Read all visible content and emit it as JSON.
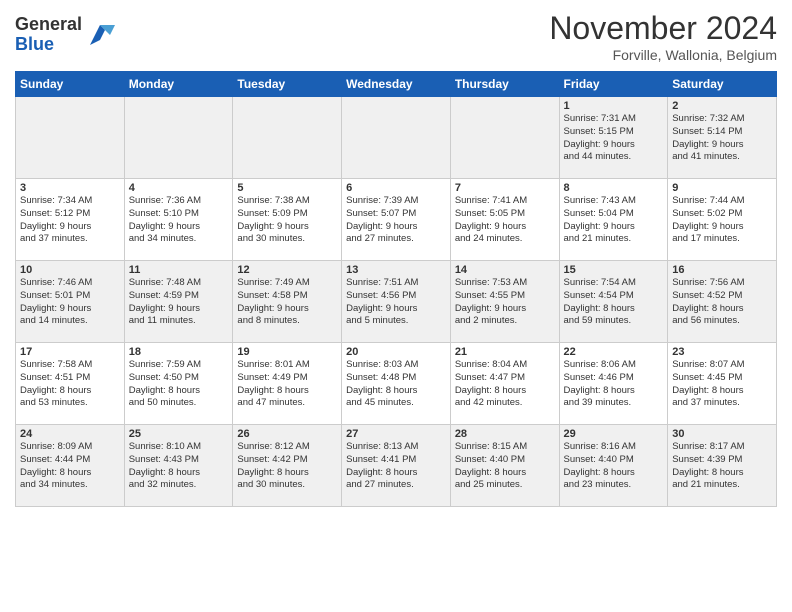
{
  "logo": {
    "line1": "General",
    "line2": "Blue"
  },
  "title": "November 2024",
  "location": "Forville, Wallonia, Belgium",
  "headers": [
    "Sunday",
    "Monday",
    "Tuesday",
    "Wednesday",
    "Thursday",
    "Friday",
    "Saturday"
  ],
  "weeks": [
    [
      {
        "day": "",
        "info": ""
      },
      {
        "day": "",
        "info": ""
      },
      {
        "day": "",
        "info": ""
      },
      {
        "day": "",
        "info": ""
      },
      {
        "day": "",
        "info": ""
      },
      {
        "day": "1",
        "info": "Sunrise: 7:31 AM\nSunset: 5:15 PM\nDaylight: 9 hours\nand 44 minutes."
      },
      {
        "day": "2",
        "info": "Sunrise: 7:32 AM\nSunset: 5:14 PM\nDaylight: 9 hours\nand 41 minutes."
      }
    ],
    [
      {
        "day": "3",
        "info": "Sunrise: 7:34 AM\nSunset: 5:12 PM\nDaylight: 9 hours\nand 37 minutes."
      },
      {
        "day": "4",
        "info": "Sunrise: 7:36 AM\nSunset: 5:10 PM\nDaylight: 9 hours\nand 34 minutes."
      },
      {
        "day": "5",
        "info": "Sunrise: 7:38 AM\nSunset: 5:09 PM\nDaylight: 9 hours\nand 30 minutes."
      },
      {
        "day": "6",
        "info": "Sunrise: 7:39 AM\nSunset: 5:07 PM\nDaylight: 9 hours\nand 27 minutes."
      },
      {
        "day": "7",
        "info": "Sunrise: 7:41 AM\nSunset: 5:05 PM\nDaylight: 9 hours\nand 24 minutes."
      },
      {
        "day": "8",
        "info": "Sunrise: 7:43 AM\nSunset: 5:04 PM\nDaylight: 9 hours\nand 21 minutes."
      },
      {
        "day": "9",
        "info": "Sunrise: 7:44 AM\nSunset: 5:02 PM\nDaylight: 9 hours\nand 17 minutes."
      }
    ],
    [
      {
        "day": "10",
        "info": "Sunrise: 7:46 AM\nSunset: 5:01 PM\nDaylight: 9 hours\nand 14 minutes."
      },
      {
        "day": "11",
        "info": "Sunrise: 7:48 AM\nSunset: 4:59 PM\nDaylight: 9 hours\nand 11 minutes."
      },
      {
        "day": "12",
        "info": "Sunrise: 7:49 AM\nSunset: 4:58 PM\nDaylight: 9 hours\nand 8 minutes."
      },
      {
        "day": "13",
        "info": "Sunrise: 7:51 AM\nSunset: 4:56 PM\nDaylight: 9 hours\nand 5 minutes."
      },
      {
        "day": "14",
        "info": "Sunrise: 7:53 AM\nSunset: 4:55 PM\nDaylight: 9 hours\nand 2 minutes."
      },
      {
        "day": "15",
        "info": "Sunrise: 7:54 AM\nSunset: 4:54 PM\nDaylight: 8 hours\nand 59 minutes."
      },
      {
        "day": "16",
        "info": "Sunrise: 7:56 AM\nSunset: 4:52 PM\nDaylight: 8 hours\nand 56 minutes."
      }
    ],
    [
      {
        "day": "17",
        "info": "Sunrise: 7:58 AM\nSunset: 4:51 PM\nDaylight: 8 hours\nand 53 minutes."
      },
      {
        "day": "18",
        "info": "Sunrise: 7:59 AM\nSunset: 4:50 PM\nDaylight: 8 hours\nand 50 minutes."
      },
      {
        "day": "19",
        "info": "Sunrise: 8:01 AM\nSunset: 4:49 PM\nDaylight: 8 hours\nand 47 minutes."
      },
      {
        "day": "20",
        "info": "Sunrise: 8:03 AM\nSunset: 4:48 PM\nDaylight: 8 hours\nand 45 minutes."
      },
      {
        "day": "21",
        "info": "Sunrise: 8:04 AM\nSunset: 4:47 PM\nDaylight: 8 hours\nand 42 minutes."
      },
      {
        "day": "22",
        "info": "Sunrise: 8:06 AM\nSunset: 4:46 PM\nDaylight: 8 hours\nand 39 minutes."
      },
      {
        "day": "23",
        "info": "Sunrise: 8:07 AM\nSunset: 4:45 PM\nDaylight: 8 hours\nand 37 minutes."
      }
    ],
    [
      {
        "day": "24",
        "info": "Sunrise: 8:09 AM\nSunset: 4:44 PM\nDaylight: 8 hours\nand 34 minutes."
      },
      {
        "day": "25",
        "info": "Sunrise: 8:10 AM\nSunset: 4:43 PM\nDaylight: 8 hours\nand 32 minutes."
      },
      {
        "day": "26",
        "info": "Sunrise: 8:12 AM\nSunset: 4:42 PM\nDaylight: 8 hours\nand 30 minutes."
      },
      {
        "day": "27",
        "info": "Sunrise: 8:13 AM\nSunset: 4:41 PM\nDaylight: 8 hours\nand 27 minutes."
      },
      {
        "day": "28",
        "info": "Sunrise: 8:15 AM\nSunset: 4:40 PM\nDaylight: 8 hours\nand 25 minutes."
      },
      {
        "day": "29",
        "info": "Sunrise: 8:16 AM\nSunset: 4:40 PM\nDaylight: 8 hours\nand 23 minutes."
      },
      {
        "day": "30",
        "info": "Sunrise: 8:17 AM\nSunset: 4:39 PM\nDaylight: 8 hours\nand 21 minutes."
      }
    ]
  ]
}
